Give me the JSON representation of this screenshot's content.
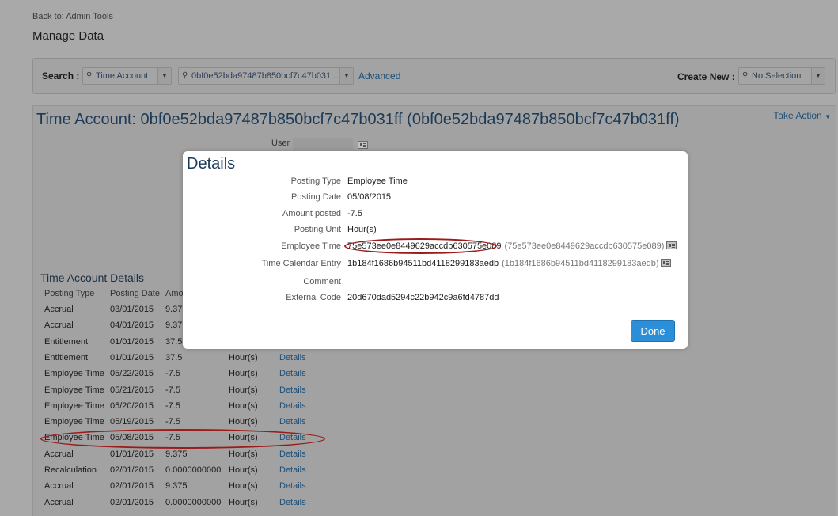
{
  "header": {
    "back_link": "Back to: Admin Tools",
    "page_title": "Manage Data"
  },
  "search": {
    "label": "Search :",
    "type_value": "Time Account",
    "entity_value": "0bf0e52bda97487b850bcf7c47b031...",
    "advanced_label": "Advanced",
    "create_new_label": "Create New :",
    "create_new_value": "No Selection"
  },
  "entity": {
    "title": "Time Account: 0bf0e52bda97487b850bcf7c47b031ff (0bf0e52bda97487b850bcf7c47b031ff)",
    "take_action": "Take Action",
    "user_label": "User"
  },
  "time_account_details": {
    "title": "Time Account Details",
    "columns": [
      "Posting Type",
      "Posting Date",
      "Amo"
    ],
    "rows": [
      {
        "type": "Accrual",
        "date": "03/01/2015",
        "amount": "9.37",
        "unit": "",
        "link": ""
      },
      {
        "type": "Accrual",
        "date": "04/01/2015",
        "amount": "9.37",
        "unit": "",
        "link": ""
      },
      {
        "type": "Entitlement",
        "date": "01/01/2015",
        "amount": "37.5",
        "unit": "",
        "link": ""
      },
      {
        "type": "Entitlement",
        "date": "01/01/2015",
        "amount": "37.5",
        "unit": "Hour(s)",
        "link": "Details"
      },
      {
        "type": "Employee Time",
        "date": "05/22/2015",
        "amount": "-7.5",
        "unit": "Hour(s)",
        "link": "Details"
      },
      {
        "type": "Employee Time",
        "date": "05/21/2015",
        "amount": "-7.5",
        "unit": "Hour(s)",
        "link": "Details"
      },
      {
        "type": "Employee Time",
        "date": "05/20/2015",
        "amount": "-7.5",
        "unit": "Hour(s)",
        "link": "Details"
      },
      {
        "type": "Employee Time",
        "date": "05/19/2015",
        "amount": "-7.5",
        "unit": "Hour(s)",
        "link": "Details"
      },
      {
        "type": "Employee Time",
        "date": "05/08/2015",
        "amount": "-7.5",
        "unit": "Hour(s)",
        "link": "Details"
      },
      {
        "type": "Accrual",
        "date": "01/01/2015",
        "amount": "9.375",
        "unit": "Hour(s)",
        "link": "Details"
      },
      {
        "type": "Recalculation",
        "date": "02/01/2015",
        "amount": "0.0000000000",
        "unit": "Hour(s)",
        "link": "Details"
      },
      {
        "type": "Accrual",
        "date": "02/01/2015",
        "amount": "9.375",
        "unit": "Hour(s)",
        "link": "Details"
      },
      {
        "type": "Accrual",
        "date": "02/01/2015",
        "amount": "0.0000000000",
        "unit": "Hour(s)",
        "link": "Details"
      }
    ]
  },
  "details_dialog": {
    "title": "Details",
    "fields": [
      {
        "label": "Posting Type",
        "value": "Employee Time",
        "extra": ""
      },
      {
        "label": "Posting Date",
        "value": "05/08/2015",
        "extra": ""
      },
      {
        "label": "Amount posted",
        "value": "-7.5",
        "extra": ""
      },
      {
        "label": "Posting Unit",
        "value": "Hour(s)",
        "extra": ""
      },
      {
        "label": "Employee Time",
        "value": "75e573ee0e8449629accdb630575e089",
        "extra": "(75e573ee0e8449629accdb630575e089)"
      },
      {
        "label": "Time Calendar Entry",
        "value": "1b184f1686b94511bd4118299183aedb",
        "extra": "(1b184f1686b94511bd4118299183aedb)"
      },
      {
        "label": "Comment",
        "value": "",
        "extra": ""
      },
      {
        "label": "External Code",
        "value": "20d670dad5294c22b942c9a6fd4787dd",
        "extra": ""
      }
    ],
    "done_label": "Done"
  },
  "colors": {
    "overlay_bg": "#a9a9a9",
    "accent": "#2b8ed8",
    "link": "#1d4f78",
    "annotation": "#9b1b1b"
  },
  "icons": [
    "search-icon",
    "chevron-down-icon",
    "lookup-icon",
    "caret-down-icon"
  ]
}
